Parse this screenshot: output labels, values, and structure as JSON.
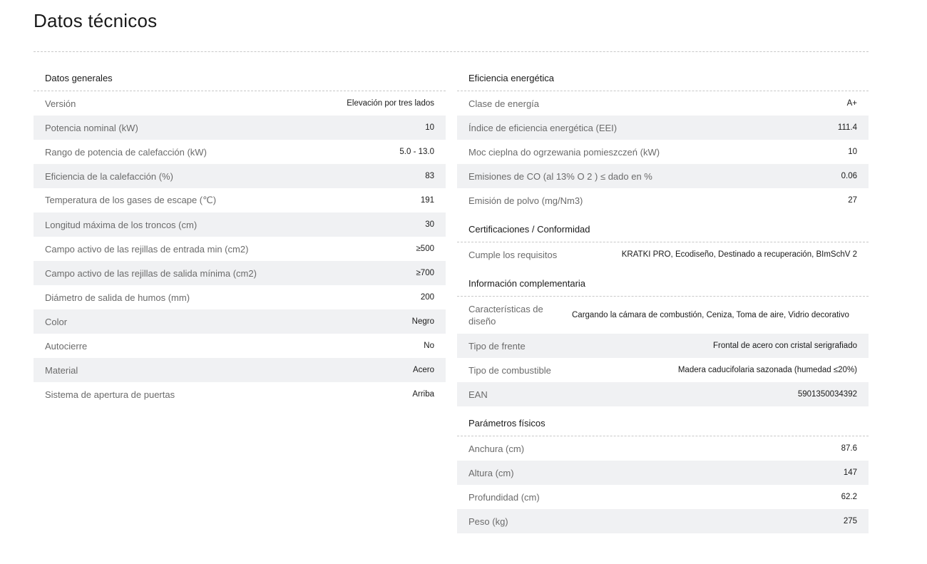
{
  "page_title": "Datos técnicos",
  "left": {
    "title": "Datos generales",
    "rows": [
      {
        "label": "Versión",
        "value": "Elevación por tres lados"
      },
      {
        "label": "Potencia nominal (kW)",
        "value": "10"
      },
      {
        "label": "Rango de potencia de calefacción (kW)",
        "value": "5.0 - 13.0"
      },
      {
        "label": "Eficiencia de la calefacción (%)",
        "value": "83"
      },
      {
        "label": "Temperatura de los gases de escape (℃)",
        "value": "191"
      },
      {
        "label": "Longitud máxima de los troncos (cm)",
        "value": "30"
      },
      {
        "label": "Campo activo de las rejillas de entrada min (cm2)",
        "value": "≥500"
      },
      {
        "label": "Campo activo de las rejillas de salida mínima (cm2)",
        "value": "≥700"
      },
      {
        "label": "Diámetro de salida de humos (mm)",
        "value": "200"
      },
      {
        "label": "Color",
        "value": "Negro"
      },
      {
        "label": "Autocierre",
        "value": "No"
      },
      {
        "label": "Material",
        "value": "Acero"
      },
      {
        "label": "Sistema de apertura de puertas",
        "value": "Arriba"
      }
    ]
  },
  "right": {
    "energy": {
      "title": "Eficiencia energética",
      "rows": [
        {
          "label": "Clase de energía",
          "value": "A+"
        },
        {
          "label": "Índice de eficiencia energética (EEI)",
          "value": "111.4"
        },
        {
          "label": "Moc cieplna do ogrzewania pomieszczeń (kW)",
          "value": "10"
        },
        {
          "label": "Emisiones de CO (al 13% O 2 ) ≤ dado en %",
          "value": "0.06"
        },
        {
          "label": "Emisión de polvo (mg/Nm3)",
          "value": "27"
        }
      ]
    },
    "cert": {
      "title": "Certificaciones / Conformidad",
      "rows": [
        {
          "label": "Cumple los requisitos",
          "value": "KRATKI PRO, Ecodiseño, Destinado a recuperación, BImSchV 2"
        }
      ]
    },
    "info": {
      "title": "Información complementaria",
      "rows": [
        {
          "label": "Características de diseño",
          "value": "Cargando la cámara de combustión, Ceniza, Toma de aire, Vidrio decorativo"
        },
        {
          "label": "Tipo de frente",
          "value": "Frontal de acero con cristal serigrafiado"
        },
        {
          "label": "Tipo de combustible",
          "value": "Madera caducifolaria sazonada (humedad ≤20%)"
        },
        {
          "label": "EAN",
          "value": "5901350034392"
        }
      ]
    },
    "physical": {
      "title": "Parámetros físicos",
      "rows": [
        {
          "label": "Anchura (cm)",
          "value": "87.6"
        },
        {
          "label": "Altura (cm)",
          "value": "147"
        },
        {
          "label": "Profundidad (cm)",
          "value": "62.2"
        },
        {
          "label": "Peso (kg)",
          "value": "275"
        }
      ]
    }
  }
}
